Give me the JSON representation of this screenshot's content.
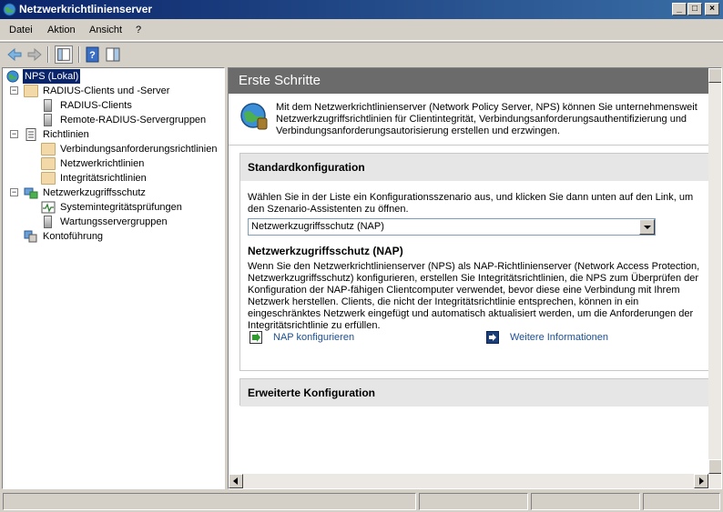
{
  "window": {
    "title": "Netzwerkrichtlinienserver",
    "icon": "nps-globe-icon",
    "controls": [
      "minimize",
      "maximize",
      "close"
    ]
  },
  "menu": [
    "Datei",
    "Aktion",
    "Ansicht",
    "?"
  ],
  "toolbar": {
    "buttons": [
      "back-arrow-icon",
      "forward-arrow-icon",
      "show-hide-tree-icon",
      "help-icon",
      "show-hide-action-pane-icon"
    ]
  },
  "tree": {
    "root": "NPS (Lokal)",
    "nodes": [
      {
        "label": "RADIUS-Clients und -Server",
        "expander": "−"
      },
      {
        "label": "RADIUS-Clients"
      },
      {
        "label": "Remote-RADIUS-Servergruppen"
      },
      {
        "label": "Richtlinien",
        "expander": "−"
      },
      {
        "label": "Verbindungsanforderungsrichtlinien"
      },
      {
        "label": "Netzwerkrichtlinien"
      },
      {
        "label": "Integritätsrichtlinien"
      },
      {
        "label": "Netzwerkzugriffsschutz",
        "expander": "−"
      },
      {
        "label": "Systemintegritätsprüfungen"
      },
      {
        "label": "Wartungsservergruppen"
      },
      {
        "label": "Kontoführung"
      }
    ]
  },
  "main": {
    "header": "Erste Schritte",
    "intro": "Mit dem Netzwerkrichtlinienserver (Network Policy Server, NPS) können Sie unternehmensweit Netzwerkzugriffsrichtlinien für Clientintegrität, Verbindungsanforderungsauthentifizierung und Verbindungsanforderungsautorisierung erstellen und erzwingen.",
    "standard": {
      "title": "Standardkonfiguration",
      "description": "Wählen Sie in der Liste ein Konfigurationsszenario aus, und klicken Sie dann unten auf den Link, um den Szenario-Assistenten zu öffnen.",
      "select_value": "Netzwerkzugriffsschutz (NAP)",
      "nap_title": "Netzwerkzugriffsschutz (NAP)",
      "nap_text": "Wenn Sie den Netzwerkrichtlinienserver (NPS) als NAP-Richtlinienserver (Network Access Protection, Netzwerkzugriffsschutz) konfigurieren, erstellen Sie Integritätsrichtlinien, die NPS zum Überprüfen der Konfiguration der NAP-fähigen Clientcomputer verwendet, bevor diese eine Verbindung mit Ihrem Netzwerk herstellen. Clients, die nicht der Integritätsrichtlinie entsprechen, können in ein eingeschränktes Netzwerk eingefügt und automatisch aktualisiert werden, um die Anforderungen der Integritätsrichtlinie zu erfüllen.",
      "link_configure": "NAP konfigurieren",
      "link_more": "Weitere Informationen"
    },
    "advanced": {
      "title": "Erweiterte Konfiguration"
    }
  },
  "colors": {
    "title_start": "#0a246a",
    "title_end": "#3a6ea5",
    "pane_header": "#6b6b6b",
    "link": "#1d4f91"
  }
}
